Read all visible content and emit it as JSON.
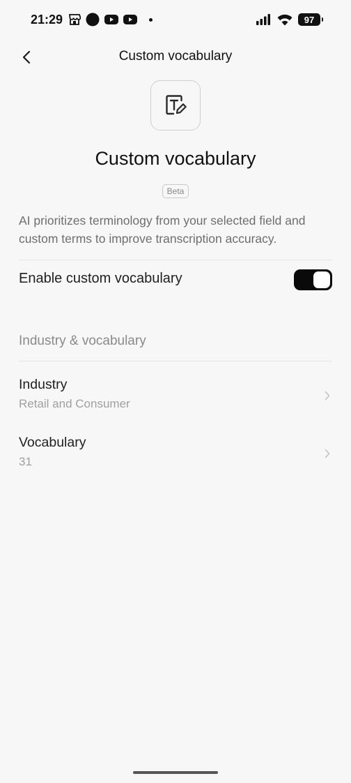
{
  "status_bar": {
    "time": "21:29",
    "battery": "97",
    "left_icons": [
      "store-icon",
      "circle-icon",
      "youtube-icon",
      "youtube-icon",
      "dot-icon"
    ],
    "right_icons": [
      "signal-icon",
      "wifi-icon",
      "battery-icon"
    ]
  },
  "nav": {
    "title": "Custom vocabulary",
    "back_icon": "chevron-left-icon"
  },
  "hero": {
    "icon": "text-edit-icon",
    "title": "Custom vocabulary",
    "badge": "Beta",
    "description": "AI prioritizes terminology from your selected field and custom terms to improve transcription accuracy."
  },
  "toggle": {
    "label": "Enable custom vocabulary",
    "enabled": true
  },
  "section": {
    "header": "Industry & vocabulary",
    "rows": [
      {
        "title": "Industry",
        "value": "Retail and Consumer"
      },
      {
        "title": "Vocabulary",
        "value": "31"
      }
    ]
  },
  "colors": {
    "background": "#f7f7f7",
    "toggle_on": "#0a0a0a",
    "secondary_text": "#6e6e6e"
  }
}
